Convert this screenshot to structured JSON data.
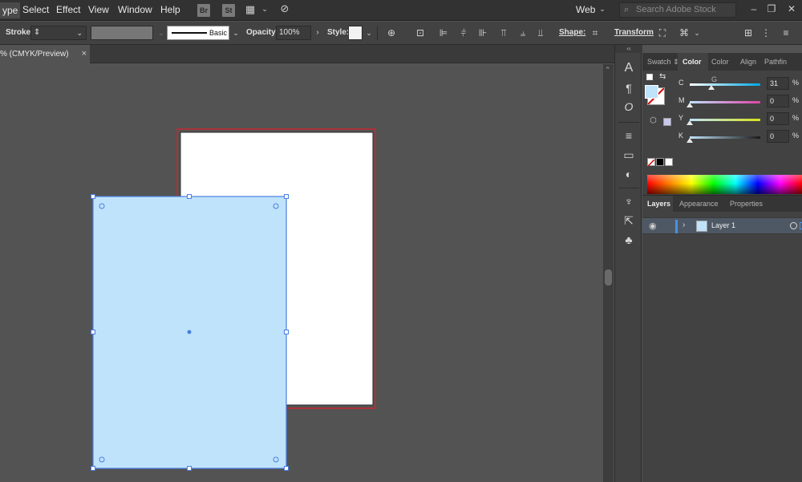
{
  "menu": {
    "items": [
      "ype",
      "Select",
      "Effect",
      "View",
      "Window",
      "Help"
    ],
    "bridge": "Br",
    "stock": "St",
    "workspace": "Web",
    "search_placeholder": "Search Adobe Stock"
  },
  "controlbar": {
    "stroke_label": "Stroke:",
    "brush_label": "Basic",
    "opacity_label": "Opacity:",
    "opacity_value": "100%",
    "style_label": "Style:",
    "shape_label": "Shape:",
    "transform_label": "Transform"
  },
  "document": {
    "tab_title": "% (CMYK/Preview)",
    "close": "×"
  },
  "color_panel": {
    "tabs": [
      "Swatch",
      "Color",
      "Color G",
      "Align",
      "Pathfin"
    ],
    "active_tab": "Color",
    "fill_color": "#bfe3fb",
    "sliders": [
      {
        "label": "C",
        "value": "31",
        "unit": "%",
        "fraction": 0.31
      },
      {
        "label": "M",
        "value": "0",
        "unit": "%",
        "fraction": 0
      },
      {
        "label": "Y",
        "value": "0",
        "unit": "%",
        "fraction": 0
      },
      {
        "label": "K",
        "value": "0",
        "unit": "%",
        "fraction": 0
      }
    ]
  },
  "layers_panel": {
    "tabs": [
      "Layers",
      "Appearance",
      "Properties"
    ],
    "active_tab": "Layers",
    "layers": [
      {
        "name": "Layer 1"
      }
    ]
  },
  "colors": {
    "selection_blue": "#4a7fe0",
    "shape_fill": "#bfe3fb",
    "artboard_border": "#c8282e",
    "artboard_fill": "#ffffff"
  }
}
